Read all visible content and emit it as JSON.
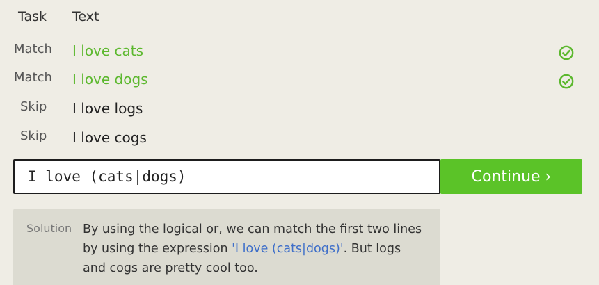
{
  "table": {
    "headers": {
      "task": "Task",
      "text": "Text"
    },
    "rows": [
      {
        "task": "Match",
        "text": "I love cats",
        "matched": true,
        "icon": "check-circle-icon"
      },
      {
        "task": "Match",
        "text": "I love dogs",
        "matched": true,
        "icon": "check-circle-icon"
      },
      {
        "task": "Skip",
        "text": "I love logs",
        "matched": false
      },
      {
        "task": "Skip",
        "text": "I love cogs",
        "matched": false
      }
    ]
  },
  "input": {
    "value": "I love (cats|dogs)"
  },
  "continue_button": {
    "label": "Continue ›"
  },
  "solution": {
    "label": "Solution",
    "text_before": "By using the logical or, we can match the first two lines by using the expression ",
    "expression": "'I love (cats|dogs)'",
    "text_after": ". But logs and cogs are pretty cool too."
  },
  "colors": {
    "background": "#efede5",
    "match_green": "#5cb82e",
    "button_green": "#5bc328",
    "solution_bg": "#dcdbd1",
    "link_blue": "#3f6fc9"
  }
}
